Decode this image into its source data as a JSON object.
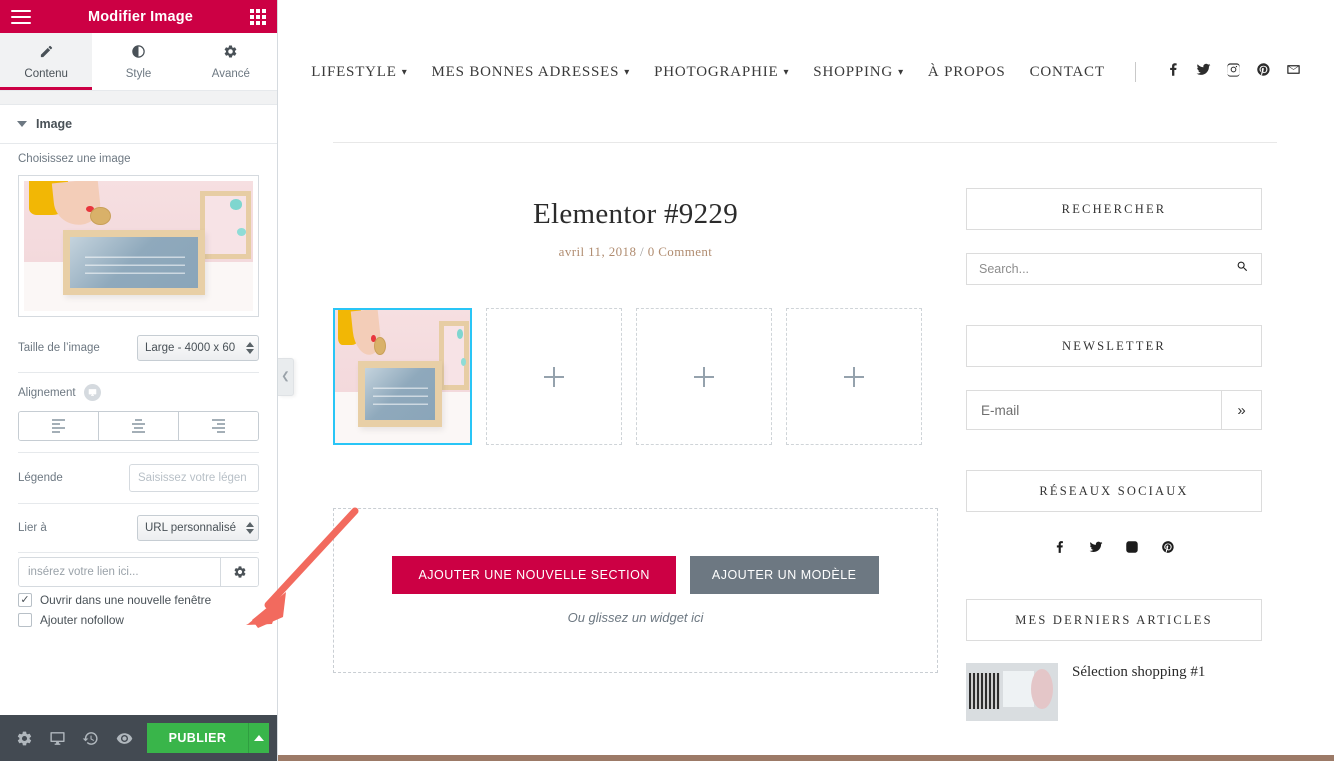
{
  "panel": {
    "title": "Modifier Image",
    "menu_icon": "hamburger-icon",
    "grid_icon": "apps-grid-icon",
    "tabs": [
      {
        "label": "Contenu",
        "icon": "pencil-icon",
        "active": true
      },
      {
        "label": "Style",
        "icon": "contrast-icon",
        "active": false
      },
      {
        "label": "Avancé",
        "icon": "gear-icon",
        "active": false
      }
    ],
    "section": {
      "label": "Image",
      "expanded": true
    },
    "controls": {
      "choose_image_label": "Choisissez une image",
      "image_size_label": "Taille de l’image",
      "image_size_value": "Large - 4000 x 60",
      "alignment_label": "Alignement",
      "alignment_options": [
        "left",
        "center",
        "right"
      ],
      "caption_label": "Légende",
      "caption_placeholder": "Saisissez votre légen",
      "caption_value": "",
      "link_to_label": "Lier à",
      "link_to_value": "URL personnalisé",
      "link_placeholder": "insérez votre lien ici...",
      "link_value": "",
      "link_gear_icon": "gear-icon",
      "checkbox_new_window": {
        "label": "Ouvrir dans une nouvelle fenêtre",
        "checked": true
      },
      "checkbox_nofollow": {
        "label": "Ajouter nofollow",
        "checked": false
      }
    },
    "footer": {
      "icons": [
        "settings-gear-icon",
        "responsive-monitor-icon",
        "history-revisions-icon",
        "preview-eye-icon"
      ],
      "publish_label": "PUBLIER",
      "publish_caret_icon": "chevron-up-icon"
    },
    "collapse_handle_icon": "chevron-left-icon"
  },
  "preview": {
    "nav": {
      "items": [
        {
          "label": "LIFESTYLE",
          "has_dropdown": true
        },
        {
          "label": "MES BONNES ADRESSES",
          "has_dropdown": true
        },
        {
          "label": "PHOTOGRAPHIE",
          "has_dropdown": true
        },
        {
          "label": "SHOPPING",
          "has_dropdown": true
        },
        {
          "label": "À PROPOS",
          "has_dropdown": false
        },
        {
          "label": "CONTACT",
          "has_dropdown": false
        }
      ],
      "social": [
        "facebook-icon",
        "twitter-icon",
        "instagram-icon",
        "pinterest-icon",
        "email-icon"
      ]
    },
    "post": {
      "title": "Elementor #9229",
      "date": "avril 11, 2018",
      "separator": "/",
      "comments": "0 Comment"
    },
    "gallery": {
      "selected_image_alt": "money-box-photo",
      "placeholder_icon": "plus-icon",
      "placeholder_count": 3
    },
    "add_section": {
      "new_section_label": "AJOUTER UNE NOUVELLE SECTION",
      "template_label": "AJOUTER UN MODÈLE",
      "hint": "Ou glissez un widget ici"
    },
    "sidebar": {
      "search_widget_title": "RECHERCHER",
      "search_placeholder": "Search...",
      "search_value": "",
      "search_icon": "search-icon",
      "newsletter_widget_title": "NEWSLETTER",
      "email_placeholder": "E-mail",
      "email_value": "",
      "email_submit_icon": "double-chevron-right-icon",
      "email_submit_label": "»",
      "social_widget_title": "RÉSEAUX SOCIAUX",
      "social_icons": [
        "facebook-icon",
        "twitter-icon",
        "instagram-icon",
        "pinterest-icon"
      ],
      "articles_widget_title": "MES DERNIERS ARTICLES",
      "articles": [
        {
          "title": "Sélection shopping #1",
          "thumb_alt": "shopping-thumbnail"
        }
      ]
    }
  },
  "colors": {
    "brand_crimson": "#cc0044",
    "publish_green": "#39b54a",
    "selection_cyan": "#29c5f6",
    "template_gray": "#6d7882",
    "annotation_red": "#f26a5e",
    "meta_tan": "#b08c70"
  },
  "annotation": {
    "arrow_color": "#f26a5e",
    "points_to": "link-settings-gear-icon"
  }
}
